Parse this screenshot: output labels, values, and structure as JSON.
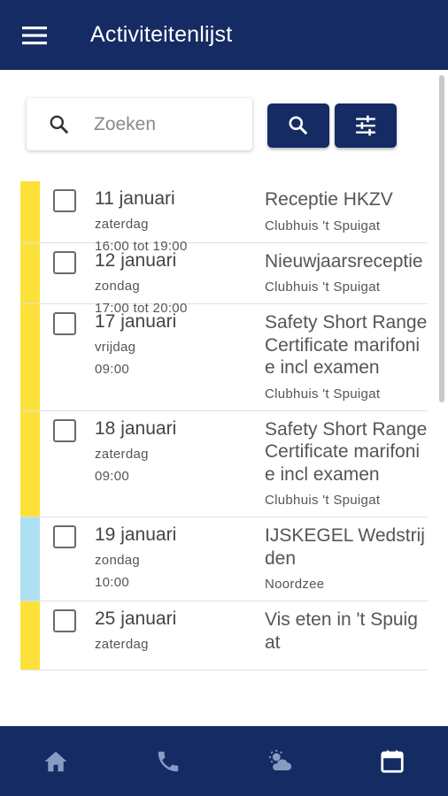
{
  "app": {
    "title": "Activiteitenlijst"
  },
  "search": {
    "placeholder": "Zoeken",
    "value": ""
  },
  "colors": {
    "primary": "#142b63",
    "stripe_yellow": "#fde13b",
    "stripe_blue": "#aee0f2"
  },
  "activities": [
    {
      "date": "11 januari",
      "day": "zaterdag",
      "time": "16:00 tot 19:00",
      "title": "Receptie HKZV",
      "location": "Clubhuis 't Spuigat",
      "color": "#fde13b",
      "checked": false
    },
    {
      "date": "12 januari",
      "day": "zondag",
      "time": "17:00 tot 20:00",
      "title": "Nieuwjaarsreceptie",
      "location": "Clubhuis 't Spuigat",
      "color": "#fde13b",
      "checked": false
    },
    {
      "date": "17 januari",
      "day": "vrijdag",
      "time": "09:00",
      "title": "Safety Short Range Certificate marifonie incl examen",
      "location": "Clubhuis 't Spuigat",
      "color": "#fde13b",
      "checked": false
    },
    {
      "date": "18 januari",
      "day": "zaterdag",
      "time": "09:00",
      "title": "Safety Short Range Certificate marifonie incl examen",
      "location": "Clubhuis 't Spuigat",
      "color": "#fde13b",
      "checked": false
    },
    {
      "date": "19 januari",
      "day": "zondag",
      "time": "10:00",
      "title": "IJSKEGEL Wedstrijden",
      "location": "Noordzee",
      "color": "#aee0f2",
      "checked": false
    },
    {
      "date": "25 januari",
      "day": "zaterdag",
      "time": "",
      "title": "Vis eten in 't Spuigat",
      "location": "",
      "color": "#fde13b",
      "checked": false
    }
  ],
  "nav": [
    {
      "name": "home-icon"
    },
    {
      "name": "phone-icon"
    },
    {
      "name": "weather-icon"
    },
    {
      "name": "calendar-icon"
    }
  ]
}
